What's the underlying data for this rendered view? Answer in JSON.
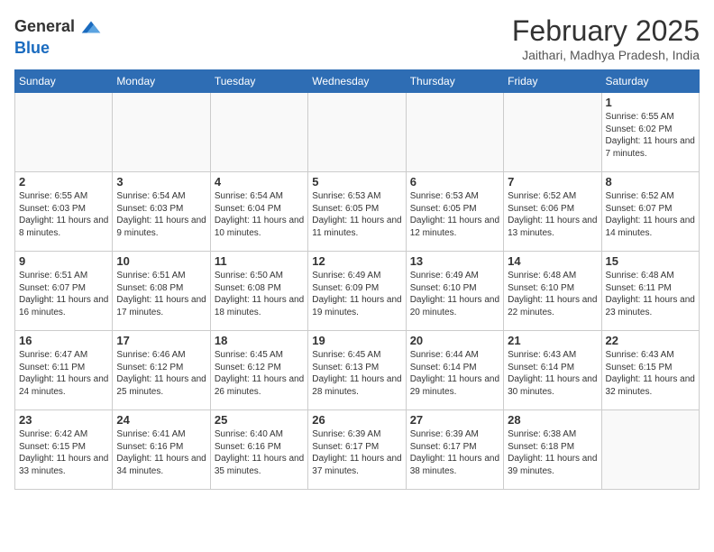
{
  "logo": {
    "general": "General",
    "blue": "Blue"
  },
  "title": "February 2025",
  "subtitle": "Jaithari, Madhya Pradesh, India",
  "weekdays": [
    "Sunday",
    "Monday",
    "Tuesday",
    "Wednesday",
    "Thursday",
    "Friday",
    "Saturday"
  ],
  "weeks": [
    [
      {
        "day": "",
        "info": ""
      },
      {
        "day": "",
        "info": ""
      },
      {
        "day": "",
        "info": ""
      },
      {
        "day": "",
        "info": ""
      },
      {
        "day": "",
        "info": ""
      },
      {
        "day": "",
        "info": ""
      },
      {
        "day": "1",
        "info": "Sunrise: 6:55 AM\nSunset: 6:02 PM\nDaylight: 11 hours and 7 minutes."
      }
    ],
    [
      {
        "day": "2",
        "info": "Sunrise: 6:55 AM\nSunset: 6:03 PM\nDaylight: 11 hours and 8 minutes."
      },
      {
        "day": "3",
        "info": "Sunrise: 6:54 AM\nSunset: 6:03 PM\nDaylight: 11 hours and 9 minutes."
      },
      {
        "day": "4",
        "info": "Sunrise: 6:54 AM\nSunset: 6:04 PM\nDaylight: 11 hours and 10 minutes."
      },
      {
        "day": "5",
        "info": "Sunrise: 6:53 AM\nSunset: 6:05 PM\nDaylight: 11 hours and 11 minutes."
      },
      {
        "day": "6",
        "info": "Sunrise: 6:53 AM\nSunset: 6:05 PM\nDaylight: 11 hours and 12 minutes."
      },
      {
        "day": "7",
        "info": "Sunrise: 6:52 AM\nSunset: 6:06 PM\nDaylight: 11 hours and 13 minutes."
      },
      {
        "day": "8",
        "info": "Sunrise: 6:52 AM\nSunset: 6:07 PM\nDaylight: 11 hours and 14 minutes."
      }
    ],
    [
      {
        "day": "9",
        "info": "Sunrise: 6:51 AM\nSunset: 6:07 PM\nDaylight: 11 hours and 16 minutes."
      },
      {
        "day": "10",
        "info": "Sunrise: 6:51 AM\nSunset: 6:08 PM\nDaylight: 11 hours and 17 minutes."
      },
      {
        "day": "11",
        "info": "Sunrise: 6:50 AM\nSunset: 6:08 PM\nDaylight: 11 hours and 18 minutes."
      },
      {
        "day": "12",
        "info": "Sunrise: 6:49 AM\nSunset: 6:09 PM\nDaylight: 11 hours and 19 minutes."
      },
      {
        "day": "13",
        "info": "Sunrise: 6:49 AM\nSunset: 6:10 PM\nDaylight: 11 hours and 20 minutes."
      },
      {
        "day": "14",
        "info": "Sunrise: 6:48 AM\nSunset: 6:10 PM\nDaylight: 11 hours and 22 minutes."
      },
      {
        "day": "15",
        "info": "Sunrise: 6:48 AM\nSunset: 6:11 PM\nDaylight: 11 hours and 23 minutes."
      }
    ],
    [
      {
        "day": "16",
        "info": "Sunrise: 6:47 AM\nSunset: 6:11 PM\nDaylight: 11 hours and 24 minutes."
      },
      {
        "day": "17",
        "info": "Sunrise: 6:46 AM\nSunset: 6:12 PM\nDaylight: 11 hours and 25 minutes."
      },
      {
        "day": "18",
        "info": "Sunrise: 6:45 AM\nSunset: 6:12 PM\nDaylight: 11 hours and 26 minutes."
      },
      {
        "day": "19",
        "info": "Sunrise: 6:45 AM\nSunset: 6:13 PM\nDaylight: 11 hours and 28 minutes."
      },
      {
        "day": "20",
        "info": "Sunrise: 6:44 AM\nSunset: 6:14 PM\nDaylight: 11 hours and 29 minutes."
      },
      {
        "day": "21",
        "info": "Sunrise: 6:43 AM\nSunset: 6:14 PM\nDaylight: 11 hours and 30 minutes."
      },
      {
        "day": "22",
        "info": "Sunrise: 6:43 AM\nSunset: 6:15 PM\nDaylight: 11 hours and 32 minutes."
      }
    ],
    [
      {
        "day": "23",
        "info": "Sunrise: 6:42 AM\nSunset: 6:15 PM\nDaylight: 11 hours and 33 minutes."
      },
      {
        "day": "24",
        "info": "Sunrise: 6:41 AM\nSunset: 6:16 PM\nDaylight: 11 hours and 34 minutes."
      },
      {
        "day": "25",
        "info": "Sunrise: 6:40 AM\nSunset: 6:16 PM\nDaylight: 11 hours and 35 minutes."
      },
      {
        "day": "26",
        "info": "Sunrise: 6:39 AM\nSunset: 6:17 PM\nDaylight: 11 hours and 37 minutes."
      },
      {
        "day": "27",
        "info": "Sunrise: 6:39 AM\nSunset: 6:17 PM\nDaylight: 11 hours and 38 minutes."
      },
      {
        "day": "28",
        "info": "Sunrise: 6:38 AM\nSunset: 6:18 PM\nDaylight: 11 hours and 39 minutes."
      },
      {
        "day": "",
        "info": ""
      }
    ]
  ]
}
